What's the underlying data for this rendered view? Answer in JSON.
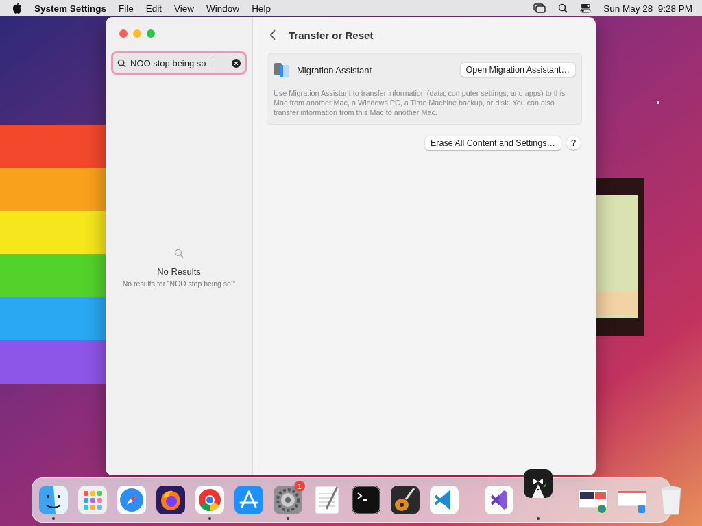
{
  "menu_bar": {
    "app_name": "System Settings",
    "menus": [
      "File",
      "Edit",
      "View",
      "Window",
      "Help"
    ],
    "clock": "Sun May 28  9:28 PM"
  },
  "sidebar": {
    "search": {
      "value": "NOO stop being so "
    },
    "empty_state": {
      "title": "No Results",
      "message": "No results for “NOO stop being so ”"
    }
  },
  "pane": {
    "title": "Transfer or Reset",
    "migration": {
      "name": "Migration Assistant",
      "button": "Open Migration Assistant…",
      "description": "Use Migration Assistant to transfer information (data, computer settings, and apps) to this Mac from another Mac, a Windows PC, a Time Machine backup, or disk. You can also transfer information from this Mac to another Mac."
    },
    "erase_button": "Erase All Content and Settings…",
    "help_button": "?"
  },
  "dock": {
    "items": [
      {
        "kind": "finder",
        "running": true
      },
      {
        "kind": "launchpad",
        "running": false
      },
      {
        "kind": "safari",
        "running": false
      },
      {
        "kind": "firefox",
        "running": false
      },
      {
        "kind": "chrome",
        "running": true
      },
      {
        "kind": "appstore",
        "running": false
      },
      {
        "kind": "settings",
        "running": true,
        "badge": "1"
      },
      {
        "kind": "textedit",
        "running": false
      },
      {
        "kind": "terminal",
        "running": false
      },
      {
        "kind": "guitar",
        "running": false
      },
      {
        "kind": "vscode",
        "running": false
      },
      {
        "kind": "separator"
      },
      {
        "kind": "visualstudio",
        "running": false
      },
      {
        "kind": "bartender",
        "running": true
      },
      {
        "kind": "separator"
      },
      {
        "kind": "window",
        "running": false
      },
      {
        "kind": "window2",
        "running": false
      },
      {
        "kind": "trash",
        "running": false
      }
    ]
  }
}
